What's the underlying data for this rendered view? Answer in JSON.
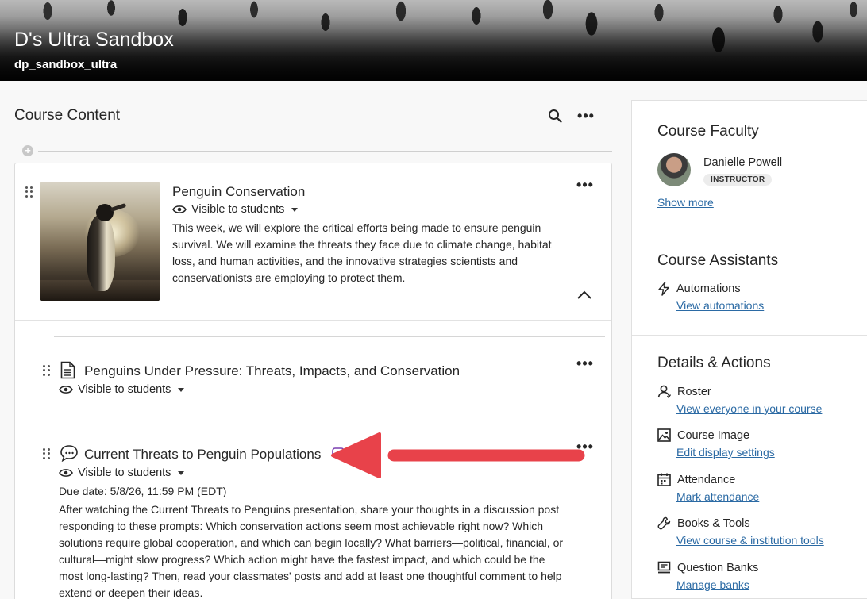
{
  "banner": {
    "title": "D's Ultra Sandbox",
    "course_id": "dp_sandbox_ultra"
  },
  "course_content": {
    "heading": "Course Content",
    "icons": {
      "search": "search-icon",
      "more": "more-options-icon",
      "add": "plus-icon"
    },
    "module": {
      "title": "Penguin Conservation",
      "visibility": "Visible to students",
      "description": "This week, we will explore the critical efforts being made to ensure penguin survival. We will examine the threats they face due to climate change, habitat loss, and human activities, and the innovative strategies scientists and conservationists are employing to protect them.",
      "items": [
        {
          "icon": "document-icon",
          "title": "Penguins Under Pressure: Threats, Impacts, and Conservation",
          "visibility": "Visible to students"
        },
        {
          "icon": "discussion-icon",
          "title": "Current Threats to Penguin Populations",
          "visibility": "Visible to students",
          "due": "Due date: 5/8/26, 11:59 PM (EDT)",
          "description": "After watching the Current Threats to Penguins presentation, share your thoughts in a discussion post responding to these prompts: Which conservation actions seem most achievable right now? Which solutions require global cooperation, and which can begin locally? What barriers—political, financial, or cultural—might slow progress? Which action might have the fastest impact, and which could be the most long-lasting? Then, read your classmates' posts and add at least one thoughtful comment to help extend or deepen their ideas."
        }
      ]
    }
  },
  "sidebar": {
    "faculty": {
      "heading": "Course Faculty",
      "name": "Danielle Powell",
      "role": "INSTRUCTOR",
      "show_more": "Show more"
    },
    "assistants": {
      "heading": "Course Assistants",
      "items": [
        {
          "icon": "lightning-icon",
          "label": "Automations",
          "link": "View automations"
        }
      ]
    },
    "details": {
      "heading": "Details & Actions",
      "items": [
        {
          "icon": "roster-icon",
          "label": "Roster",
          "link": "View everyone in your course"
        },
        {
          "icon": "image-icon",
          "label": "Course Image",
          "link": "Edit display settings"
        },
        {
          "icon": "calendar-icon",
          "label": "Attendance",
          "link": "Mark attendance"
        },
        {
          "icon": "wrench-icon",
          "label": "Books & Tools",
          "link": "View course & institution tools"
        },
        {
          "icon": "question-bank-icon",
          "label": "Question Banks",
          "link": "Manage banks"
        }
      ]
    }
  },
  "colors": {
    "link": "#2b6aa4",
    "annotation_arrow": "#e8424a",
    "text": "#262626"
  }
}
